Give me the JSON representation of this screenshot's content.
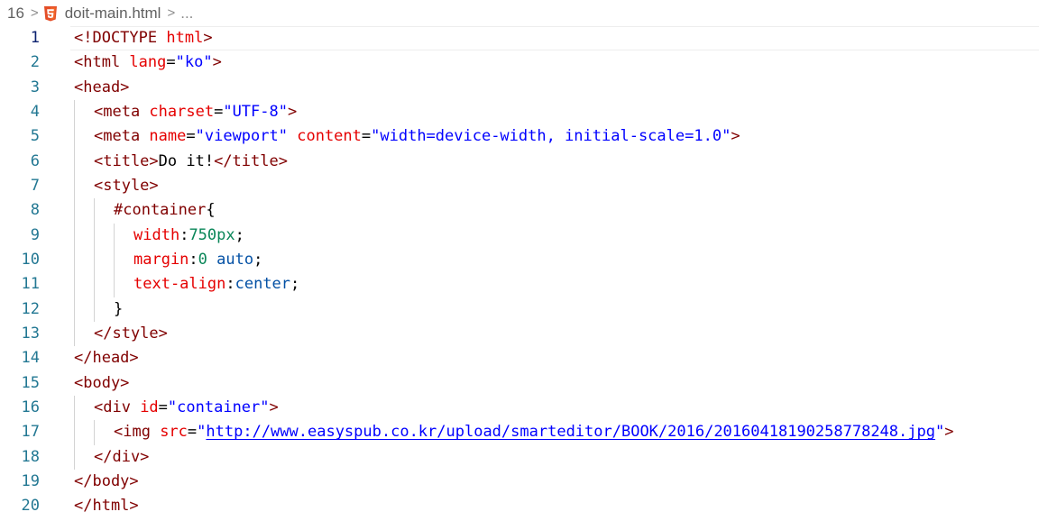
{
  "breadcrumb": {
    "prefix": "16",
    "separator": ">",
    "file_icon": "html5-icon",
    "file_name": "doit-main.html",
    "more": "..."
  },
  "editor": {
    "active_line": 1,
    "lines": [
      {
        "n": "1",
        "indent": 0,
        "tokens": [
          [
            "tag",
            "<!DOCTYPE "
          ],
          [
            "attr",
            "html"
          ],
          [
            "tag",
            ">"
          ]
        ]
      },
      {
        "n": "2",
        "indent": 0,
        "tokens": [
          [
            "tag",
            "<html "
          ],
          [
            "attr",
            "lang"
          ],
          [
            "text",
            "="
          ],
          [
            "str",
            "\"ko\""
          ],
          [
            "tag",
            ">"
          ]
        ]
      },
      {
        "n": "3",
        "indent": 0,
        "tokens": [
          [
            "tag",
            "<head>"
          ]
        ]
      },
      {
        "n": "4",
        "indent": 1,
        "tokens": [
          [
            "tag",
            "<meta "
          ],
          [
            "attr",
            "charset"
          ],
          [
            "text",
            "="
          ],
          [
            "str",
            "\"UTF-8\""
          ],
          [
            "tag",
            ">"
          ]
        ]
      },
      {
        "n": "5",
        "indent": 1,
        "tokens": [
          [
            "tag",
            "<meta "
          ],
          [
            "attr",
            "name"
          ],
          [
            "text",
            "="
          ],
          [
            "str",
            "\"viewport\""
          ],
          [
            "text",
            " "
          ],
          [
            "attr",
            "content"
          ],
          [
            "text",
            "="
          ],
          [
            "str",
            "\"width=device-width, initial-scale=1.0\""
          ],
          [
            "tag",
            ">"
          ]
        ]
      },
      {
        "n": "6",
        "indent": 1,
        "tokens": [
          [
            "tag",
            "<title>"
          ],
          [
            "text",
            "Do it!"
          ],
          [
            "tag",
            "</title>"
          ]
        ]
      },
      {
        "n": "7",
        "indent": 1,
        "tokens": [
          [
            "tag",
            "<style>"
          ]
        ]
      },
      {
        "n": "8",
        "indent": 2,
        "tokens": [
          [
            "sel",
            "#container"
          ],
          [
            "text",
            "{"
          ]
        ]
      },
      {
        "n": "9",
        "indent": 3,
        "tokens": [
          [
            "attr",
            "width"
          ],
          [
            "text",
            ":"
          ],
          [
            "num",
            "750px"
          ],
          [
            "text",
            ";"
          ]
        ]
      },
      {
        "n": "10",
        "indent": 3,
        "tokens": [
          [
            "attr",
            "margin"
          ],
          [
            "text",
            ":"
          ],
          [
            "num",
            "0"
          ],
          [
            "text",
            " "
          ],
          [
            "kw",
            "auto"
          ],
          [
            "text",
            ";"
          ]
        ]
      },
      {
        "n": "11",
        "indent": 3,
        "tokens": [
          [
            "attr",
            "text-align"
          ],
          [
            "text",
            ":"
          ],
          [
            "kw",
            "center"
          ],
          [
            "text",
            ";"
          ]
        ]
      },
      {
        "n": "12",
        "indent": 2,
        "tokens": [
          [
            "text",
            "}"
          ]
        ]
      },
      {
        "n": "13",
        "indent": 1,
        "tokens": [
          [
            "tag",
            "</style>"
          ]
        ]
      },
      {
        "n": "14",
        "indent": 0,
        "tokens": [
          [
            "tag",
            "</head>"
          ]
        ]
      },
      {
        "n": "15",
        "indent": 0,
        "tokens": [
          [
            "tag",
            "<body>"
          ]
        ]
      },
      {
        "n": "16",
        "indent": 1,
        "tokens": [
          [
            "tag",
            "<div "
          ],
          [
            "attr",
            "id"
          ],
          [
            "text",
            "="
          ],
          [
            "str",
            "\"container\""
          ],
          [
            "tag",
            ">"
          ]
        ]
      },
      {
        "n": "17",
        "indent": 2,
        "tokens": [
          [
            "tag",
            "<img "
          ],
          [
            "attr",
            "src"
          ],
          [
            "text",
            "="
          ],
          [
            "str",
            "\""
          ],
          [
            "link",
            "http://www.easyspub.co.kr/upload/smarteditor/BOOK/2016/2016041819025877824​8.jpg"
          ],
          [
            "str",
            "\""
          ],
          [
            "tag",
            ">"
          ]
        ]
      },
      {
        "n": "18",
        "indent": 1,
        "tokens": [
          [
            "tag",
            "</div>"
          ]
        ]
      },
      {
        "n": "19",
        "indent": 0,
        "tokens": [
          [
            "tag",
            "</body>"
          ]
        ]
      },
      {
        "n": "20",
        "indent": 0,
        "tokens": [
          [
            "tag",
            "</html>"
          ]
        ]
      }
    ]
  }
}
